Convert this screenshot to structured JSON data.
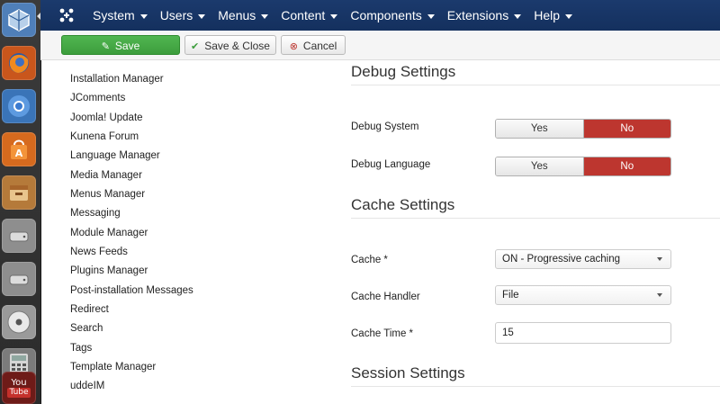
{
  "launcher": {
    "icons": [
      {
        "name": "virtualbox-icon",
        "color": "#5b8bc5"
      },
      {
        "name": "firefox-icon",
        "color": "#e96a1f"
      },
      {
        "name": "chromium-icon",
        "color": "#4a90d9"
      },
      {
        "name": "software-center-icon",
        "color": "#e0701f"
      },
      {
        "name": "file-manager-icon",
        "color": "#d9a35a"
      },
      {
        "name": "drive-icon-1",
        "color": "#b9b9b9"
      },
      {
        "name": "drive-icon-2",
        "color": "#b9b9b9"
      },
      {
        "name": "cd-icon",
        "color": "#c8c8c8"
      },
      {
        "name": "calculator-icon",
        "color": "#9a9a9a"
      },
      {
        "name": "youtube-icon",
        "color": "#c4302b",
        "label_top": "You",
        "label_bottom": "Tube"
      }
    ]
  },
  "navbar": {
    "menu": [
      "System",
      "Users",
      "Menus",
      "Content",
      "Components",
      "Extensions",
      "Help"
    ]
  },
  "toolbar": {
    "save_label": "Save",
    "save_close_label": "Save & Close",
    "cancel_label": "Cancel"
  },
  "sidebar": {
    "items": [
      "Installation Manager",
      "JComments",
      "Joomla! Update",
      "Kunena Forum",
      "Language Manager",
      "Media Manager",
      "Menus Manager",
      "Messaging",
      "Module Manager",
      "News Feeds",
      "Plugins Manager",
      "Post-installation Messages",
      "Redirect",
      "Search",
      "Tags",
      "Template Manager",
      "uddeIM"
    ]
  },
  "settings": {
    "debug_title": "Debug Settings",
    "debug_system_label": "Debug System",
    "debug_language_label": "Debug Language",
    "yes_label": "Yes",
    "no_label": "No",
    "cache_title": "Cache Settings",
    "cache_label": "Cache *",
    "cache_value": "ON - Progressive caching",
    "cache_handler_label": "Cache Handler",
    "cache_handler_value": "File",
    "cache_time_label": "Cache Time *",
    "cache_time_value": "15",
    "session_title": "Session Settings"
  }
}
